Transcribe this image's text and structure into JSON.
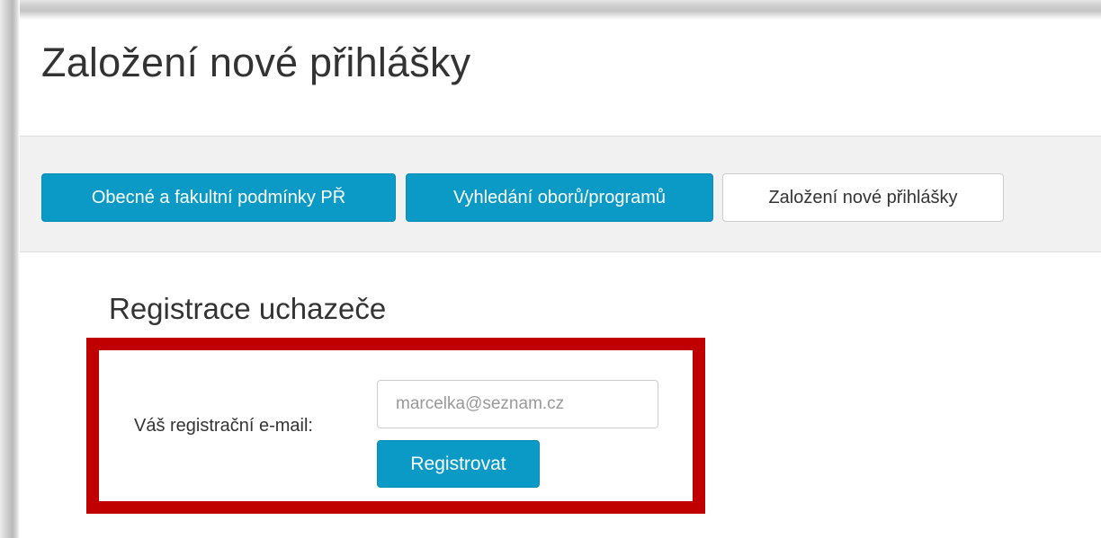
{
  "header": {
    "title": "Založení nové přihlášky"
  },
  "nav": {
    "buttons": [
      {
        "label": "Obecné a fakultní podmínky PŘ"
      },
      {
        "label": "Vyhledání oborů/programů"
      },
      {
        "label": "Založení nové přihlášky"
      }
    ]
  },
  "registration": {
    "title": "Registrace uchazeče",
    "email_label": "Váš registrační e-mail:",
    "email_placeholder": "marcelka@seznam.cz",
    "submit_label": "Registrovat"
  },
  "colors": {
    "primary": "#0b9ac6",
    "highlight": "#c00000",
    "nav_band": "#f1f1f1"
  }
}
